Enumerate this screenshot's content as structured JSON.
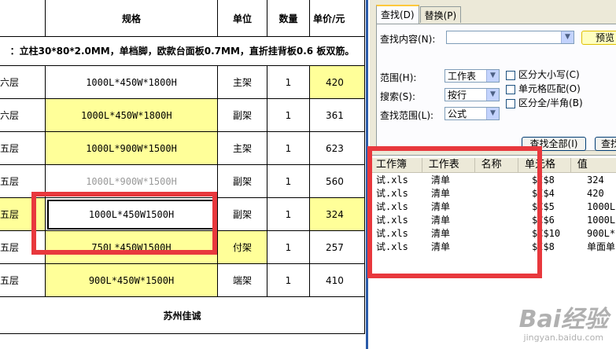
{
  "sheet": {
    "headers": [
      "",
      "规格",
      "单位",
      "数量",
      "单价/元"
    ],
    "description": "：立柱30*80*2.0MM，单档脚，欧款台面板0.7MM，直折挂背板0.6 板双筋。",
    "rows": [
      {
        "layer": "六层",
        "spec": "1000L*450W*1800H",
        "unit": "主架",
        "qty": "1",
        "price": "420"
      },
      {
        "layer": "六层",
        "spec": "1000L*450W*1800H",
        "unit": "副架",
        "qty": "1",
        "price": "361"
      },
      {
        "layer": "五层",
        "spec": "1000L*900W*1500H",
        "unit": "主架",
        "qty": "1",
        "price": "623"
      },
      {
        "layer": "五层",
        "spec": "1000L*900W*1500H",
        "unit": "副架",
        "qty": "1",
        "price": "560"
      },
      {
        "layer": "五层",
        "spec": "1000L*450W1500H",
        "unit": "副架",
        "qty": "1",
        "price": "324"
      },
      {
        "layer": "五层",
        "spec": "750L*450W1500H",
        "unit": "付架",
        "qty": "1",
        "price": "257"
      },
      {
        "layer": "五层",
        "spec": "900L*450W*1500H",
        "unit": "端架",
        "qty": "1",
        "price": "410"
      }
    ],
    "footer": "苏州佳诚",
    "colors": {
      "highlight": "#ffff99",
      "grid": "#000000"
    }
  },
  "dialog": {
    "tabs": [
      "查找(D)",
      "替换(P)"
    ],
    "find_label": "查找内容(N):",
    "find_value": "",
    "preview_label": "预览",
    "scope_label": "范围(H):",
    "scope_value": "工作表",
    "search_label": "搜索(S):",
    "search_value": "按行",
    "lookin_label": "查找范围(L):",
    "lookin_value": "公式",
    "match_case": "区分大小写(C)",
    "match_cell": "单元格匹配(O)",
    "match_width": "区分全/半角(B)",
    "find_all": "查找全部(I)",
    "find_next": "查找",
    "results_headers": [
      "工作簿",
      "工作表",
      "名称",
      "单元格",
      "值"
    ],
    "results": [
      {
        "book": "试.xls",
        "sheet": "清单",
        "name": "",
        "cell": "$I$8",
        "value": "324"
      },
      {
        "book": "试.xls",
        "sheet": "清单",
        "name": "",
        "cell": "$I$4",
        "value": "420"
      },
      {
        "book": "试.xls",
        "sheet": "清单",
        "name": "",
        "cell": "$C$5",
        "value": "1000L"
      },
      {
        "book": "试.xls",
        "sheet": "清单",
        "name": "",
        "cell": "$C$6",
        "value": "1000L"
      },
      {
        "book": "试.xls",
        "sheet": "清单",
        "name": "",
        "cell": "$C$10",
        "value": "900L*"
      },
      {
        "book": "试.xls",
        "sheet": "清单",
        "name": "",
        "cell": "$I$8",
        "value": "单面单"
      }
    ]
  },
  "annotation_color": "#e8383d",
  "watermark": {
    "big": "Bai经验",
    "small": "jingyan.baidu.com"
  }
}
